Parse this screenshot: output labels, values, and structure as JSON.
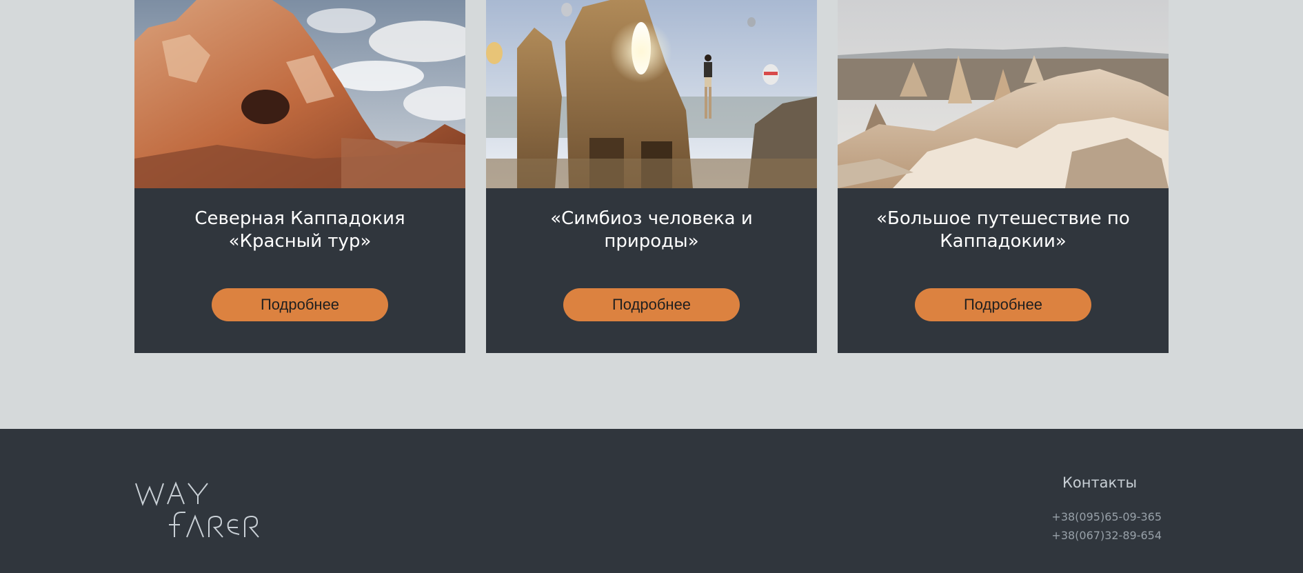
{
  "tours": [
    {
      "title": "Северная Каппадокия «Красный тур»",
      "button_label": "Подробнее",
      "image_icon": "red-rock-formation-photo"
    },
    {
      "title": "«Симбиоз человека и природы»",
      "button_label": "Подробнее",
      "image_icon": "hiker-and-balloons-photo"
    },
    {
      "title": "«Большое путешествие по Каппадокии»",
      "button_label": "Подробнее",
      "image_icon": "fairy-chimneys-photo"
    }
  ],
  "footer": {
    "logo_text": "WAY FARER",
    "contacts_title": "Контакты",
    "phones": [
      "+38(095)65-09-365",
      "+38(067)32-89-654"
    ]
  },
  "colors": {
    "page_bg": "#d5d9da",
    "card_bg": "#30363d",
    "accent": "#dc8240",
    "footer_bg": "#30363d"
  }
}
